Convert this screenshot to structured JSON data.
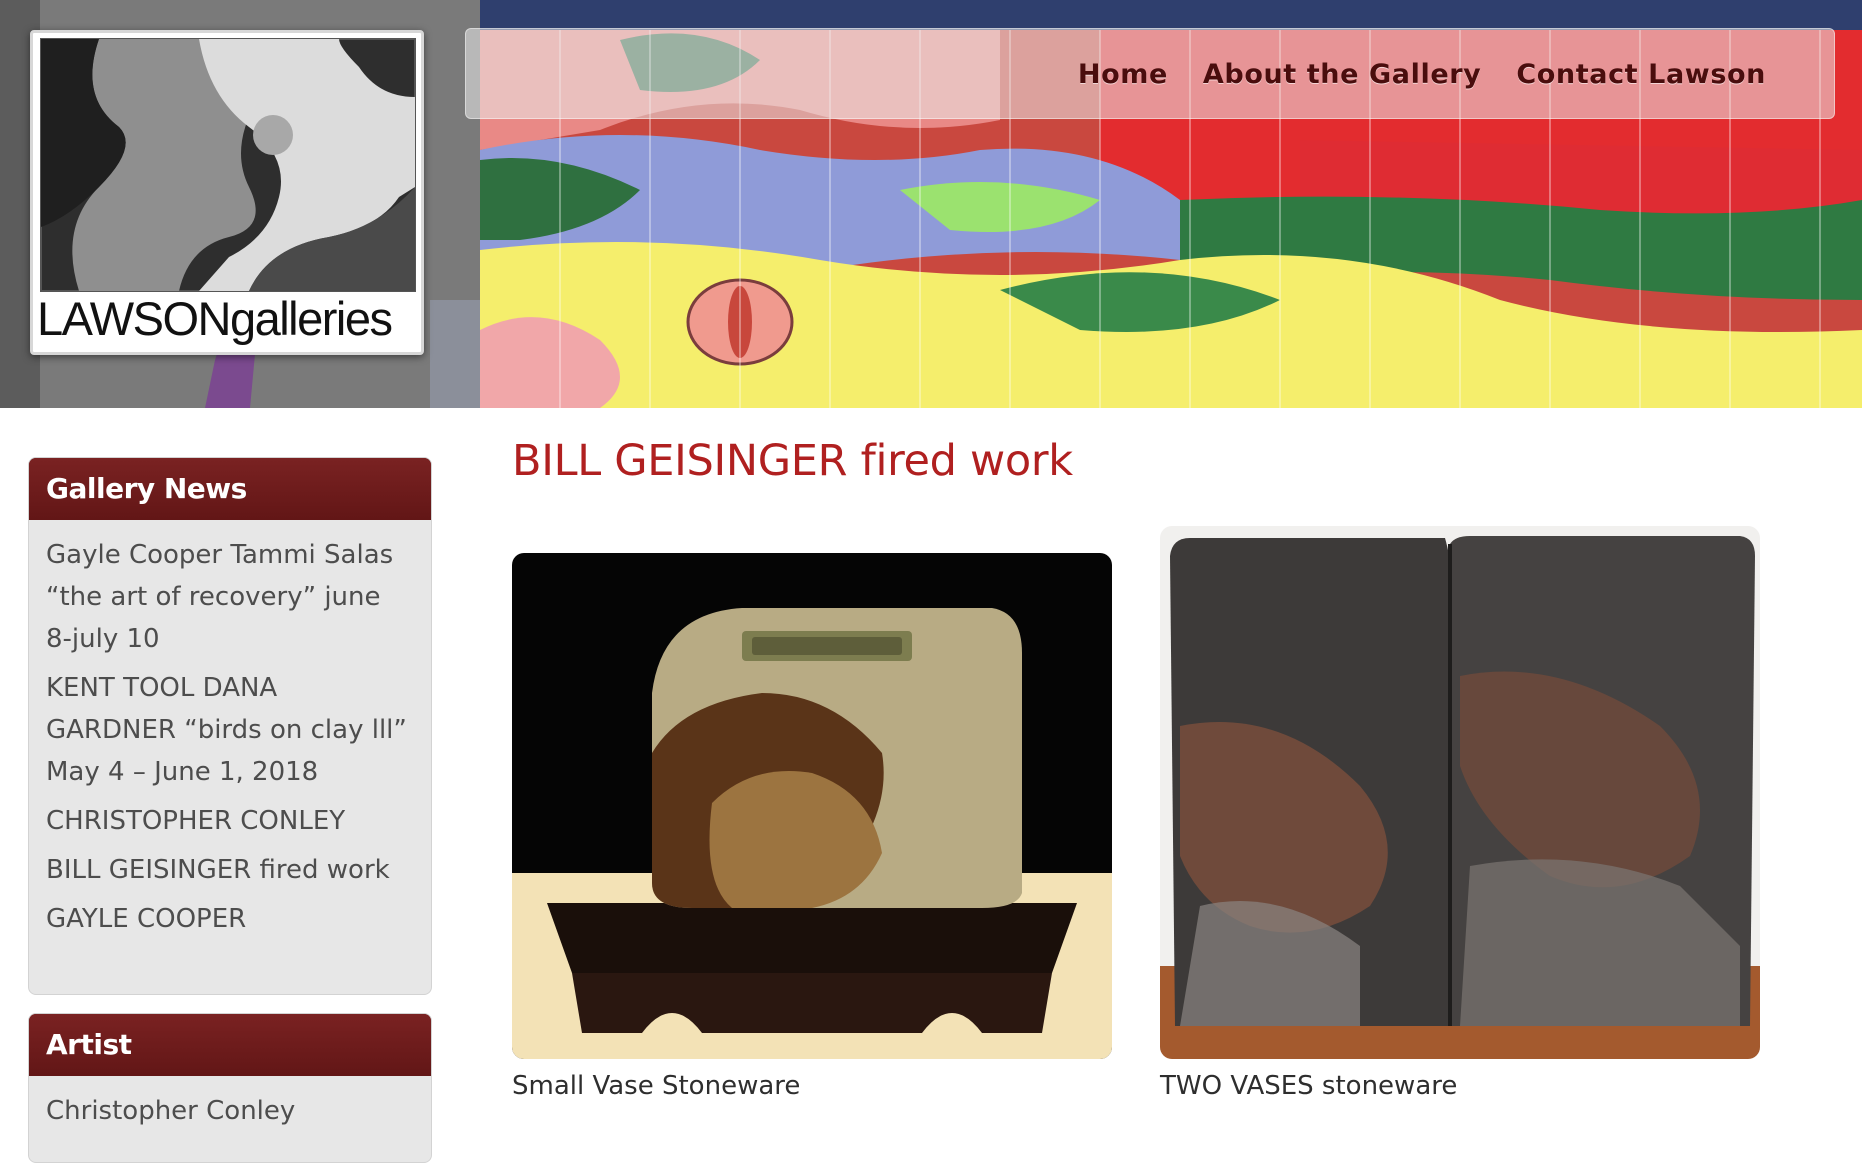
{
  "logo": {
    "brand_strong": "LAWSON",
    "brand_light": "galleries"
  },
  "nav": {
    "items": [
      {
        "label": "Home"
      },
      {
        "label": "About the Gallery"
      },
      {
        "label": "Contact Lawson"
      }
    ]
  },
  "sidebar": {
    "news": {
      "title": "Gallery News",
      "items": [
        {
          "label": "Gayle Cooper Tammi Salas “the art of recovery” june 8-july 10"
        },
        {
          "label": "KENT TOOL DANA GARDNER “birds on clay lll” May 4 – June 1, 2018"
        },
        {
          "label": "CHRISTOPHER CONLEY"
        },
        {
          "label": "BILL GEISINGER fired work"
        },
        {
          "label": "GAYLE COOPER"
        }
      ]
    },
    "artist": {
      "title": "Artist",
      "items": [
        {
          "label": "Christopher Conley"
        }
      ]
    }
  },
  "main": {
    "title": "BILL GEISINGER fired work",
    "gallery": [
      {
        "caption": "Small Vase Stoneware"
      },
      {
        "caption": "TWO VASES stoneware"
      }
    ]
  },
  "colors": {
    "accent_red": "#b02020",
    "widget_header": "#6f1a1a",
    "nav_text": "#4a0d0d"
  }
}
